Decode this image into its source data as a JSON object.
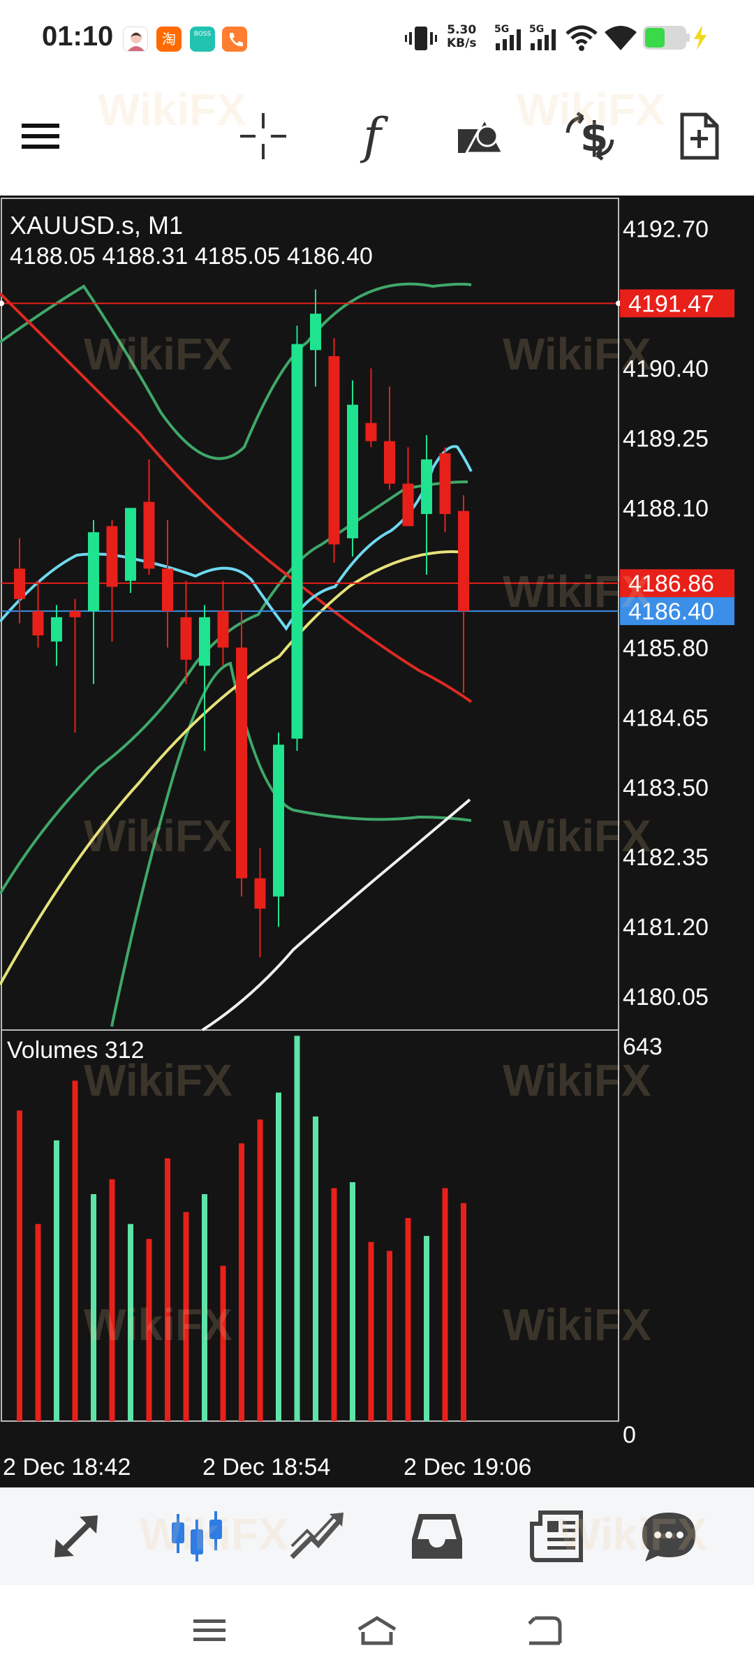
{
  "status_bar": {
    "time": "01:10",
    "net_speed_value": "5.30",
    "net_speed_unit": "KB/s",
    "signal1": "5G",
    "signal2": "5G",
    "notif_taobao": "淘",
    "notif_boss": "BOSS"
  },
  "toolbar": {
    "function_label": "f"
  },
  "chart": {
    "symbol_title": "XAUUSD.s, M1",
    "ohlc": "4188.05 4188.31 4185.05 4186.40",
    "price_axis_ticks": [
      "4192.70",
      "4190.40",
      "4189.25",
      "4188.10",
      "4185.80",
      "4184.65",
      "4183.50",
      "4182.35",
      "4181.20",
      "4180.05"
    ],
    "price_axis_values": [
      4192.7,
      4190.4,
      4189.25,
      4188.1,
      4185.8,
      4184.65,
      4183.5,
      4182.35,
      4181.2,
      4180.05
    ],
    "level_line_high": "4191.47",
    "level_line_high_value": 4191.47,
    "level_line_ask": "4186.86",
    "level_line_ask_value": 4186.86,
    "level_line_bid": "4186.40",
    "level_line_bid_value": 4186.4,
    "volumes_title": "Volumes 312",
    "volume_axis_max": "643",
    "volume_axis_min": "0",
    "time_labels": [
      "2 Dec 18:42",
      "2 Dec 18:54",
      "2 Dec 19:06"
    ],
    "colors": {
      "bull": "#1fe38f",
      "bear": "#e8201a",
      "background": "#141414",
      "ask_line": "#e8201a",
      "bid_line": "#3b8fe8"
    }
  },
  "chart_data": {
    "type": "candlestick",
    "symbol": "XAUUSD.s",
    "timeframe": "M1",
    "ylim": [
      4179.5,
      4193.2
    ],
    "candles": [
      {
        "o": 4187.1,
        "h": 4187.6,
        "l": 4186.2,
        "c": 4186.6
      },
      {
        "o": 4186.4,
        "h": 4186.9,
        "l": 4185.8,
        "c": 4186.0
      },
      {
        "o": 4185.9,
        "h": 4186.5,
        "l": 4185.5,
        "c": 4186.3
      },
      {
        "o": 4186.4,
        "h": 4186.6,
        "l": 4184.4,
        "c": 4186.3
      },
      {
        "o": 4186.4,
        "h": 4187.9,
        "l": 4185.2,
        "c": 4187.7
      },
      {
        "o": 4187.8,
        "h": 4187.9,
        "l": 4185.9,
        "c": 4186.8
      },
      {
        "o": 4186.9,
        "h": 4188.0,
        "l": 4186.7,
        "c": 4188.1
      },
      {
        "o": 4188.2,
        "h": 4188.9,
        "l": 4187.0,
        "c": 4187.1
      },
      {
        "o": 4187.1,
        "h": 4187.9,
        "l": 4185.8,
        "c": 4186.4
      },
      {
        "o": 4186.3,
        "h": 4186.9,
        "l": 4185.2,
        "c": 4185.6
      },
      {
        "o": 4185.5,
        "h": 4186.5,
        "l": 4184.1,
        "c": 4186.3
      },
      {
        "o": 4186.4,
        "h": 4186.9,
        "l": 4185.5,
        "c": 4185.8
      },
      {
        "o": 4185.8,
        "h": 4186.4,
        "l": 4181.7,
        "c": 4182.0
      },
      {
        "o": 4182.0,
        "h": 4182.5,
        "l": 4180.7,
        "c": 4181.5
      },
      {
        "o": 4181.7,
        "h": 4184.4,
        "l": 4181.2,
        "c": 4184.2
      },
      {
        "o": 4184.3,
        "h": 4191.1,
        "l": 4184.1,
        "c": 4190.8
      },
      {
        "o": 4190.7,
        "h": 4191.7,
        "l": 4190.1,
        "c": 4191.3
      },
      {
        "o": 4190.6,
        "h": 4190.9,
        "l": 4187.2,
        "c": 4187.5
      },
      {
        "o": 4187.6,
        "h": 4190.2,
        "l": 4187.3,
        "c": 4189.8
      },
      {
        "o": 4189.5,
        "h": 4190.4,
        "l": 4189.1,
        "c": 4189.2
      },
      {
        "o": 4189.2,
        "h": 4190.1,
        "l": 4188.4,
        "c": 4188.5
      },
      {
        "o": 4188.5,
        "h": 4189.1,
        "l": 4187.9,
        "c": 4187.8
      },
      {
        "o": 4188.0,
        "h": 4189.3,
        "l": 4187.0,
        "c": 4188.9
      },
      {
        "o": 4189.0,
        "h": 4189.1,
        "l": 4187.7,
        "c": 4188.0
      },
      {
        "o": 4188.05,
        "h": 4188.31,
        "l": 4185.05,
        "c": 4186.4
      }
    ],
    "volumes": [
      520,
      330,
      470,
      570,
      380,
      405,
      330,
      305,
      440,
      350,
      380,
      260,
      465,
      505,
      550,
      645,
      510,
      390,
      400,
      300,
      285,
      340,
      310,
      390,
      365
    ],
    "volume_ylim": [
      0,
      643
    ],
    "time_labels": [
      "2 Dec 18:42",
      "2 Dec 18:54",
      "2 Dec 19:06"
    ]
  },
  "bottom_nav": {
    "items": [
      "quotes",
      "chart",
      "trade",
      "history",
      "news",
      "messages"
    ]
  }
}
